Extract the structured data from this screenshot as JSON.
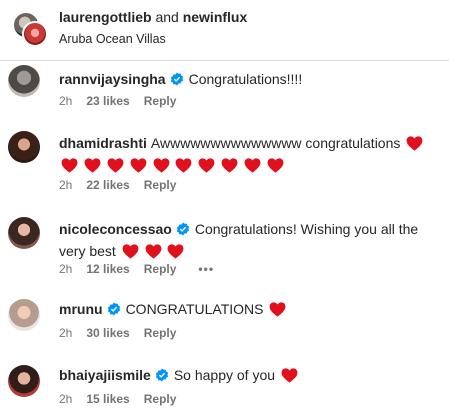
{
  "header": {
    "user1": "laurengottlieb",
    "joiner": " and ",
    "user2": "newinflux",
    "location": "Aruba Ocean Villas"
  },
  "comments": [
    {
      "username": "rannvijaysingha",
      "verified": true,
      "text": "Congratulations!!!!",
      "hearts": 0,
      "time": "2h",
      "likes": "23 likes",
      "reply": "Reply"
    },
    {
      "username": "dhamidrashti",
      "verified": false,
      "text": "Awwwwwwwwwwwwww congratulations",
      "hearts": 11,
      "time": "2h",
      "likes": "22 likes",
      "reply": "Reply"
    },
    {
      "username": "nicoleconcessao",
      "verified": true,
      "text": "Congratulations! Wishing you all the very best",
      "hearts": 3,
      "time": "2h",
      "likes": "12 likes",
      "reply": "Reply",
      "more": "•••"
    },
    {
      "username": "mrunu",
      "verified": true,
      "text": "CONGRATULATIONS",
      "hearts": 1,
      "time": "2h",
      "likes": "30 likes",
      "reply": "Reply"
    },
    {
      "username": "bhaiyajiismile",
      "verified": true,
      "text": "So happy of you",
      "hearts": 1,
      "time": "2h",
      "likes": "15 likes",
      "reply": "Reply"
    }
  ],
  "colors": {
    "verified": "#0095f6",
    "heart": "#e0101d",
    "meta": "#737373"
  },
  "icons": {
    "verified": "verified-badge-icon",
    "heart": "red-heart-icon"
  }
}
